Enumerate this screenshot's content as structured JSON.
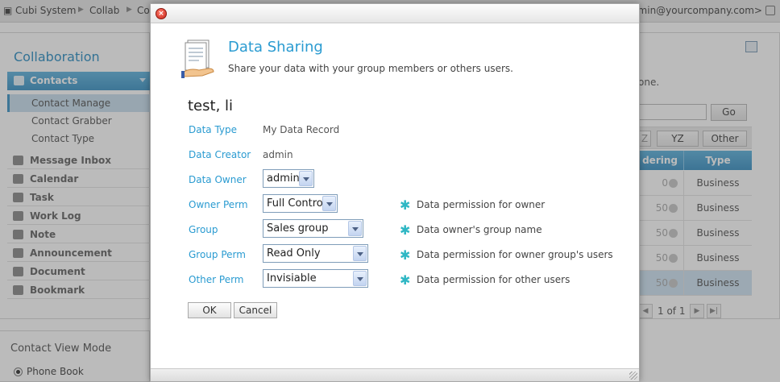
{
  "topbar": {
    "breadcrumbs": [
      "Cubi System",
      "Collab",
      "Co"
    ],
    "user": "admin@yourcompany.com>"
  },
  "sidebar": {
    "title": "Collaboration",
    "contacts_label": "Contacts",
    "subitems": [
      "Contact Manage",
      "Contact Grabber",
      "Contact Type"
    ],
    "items": [
      "Message Inbox",
      "Calendar",
      "Task",
      "Work Log",
      "Note",
      "Announcement",
      "Document",
      "Bookmark"
    ]
  },
  "view_mode": {
    "title": "Contact View Mode",
    "option": "Phone Book"
  },
  "main": {
    "note_fragment": "one.",
    "go_label": "Go",
    "alpha_buttons": [
      "Z",
      "YZ",
      "Other"
    ],
    "col_ordering": "dering",
    "col_type": "Type",
    "rows": [
      {
        "order": "0",
        "type": "Business"
      },
      {
        "order": "50",
        "type": "Business"
      },
      {
        "order": "50",
        "type": "Business"
      },
      {
        "order": "50",
        "type": "Business"
      },
      {
        "order": "50",
        "type": "Business"
      }
    ],
    "page_info": "1 of 1"
  },
  "dialog": {
    "title": "Data Sharing",
    "subtitle": "Share your data with your group members or others users.",
    "record_name": "test, li",
    "fields": {
      "data_type": {
        "label": "Data Type",
        "value": "My Data Record"
      },
      "data_creator": {
        "label": "Data Creator",
        "value": "admin"
      },
      "data_owner": {
        "label": "Data Owner",
        "value": "admin"
      },
      "owner_perm": {
        "label": "Owner Perm",
        "value": "Full Control",
        "hint": "Data permission for owner"
      },
      "group": {
        "label": "Group",
        "value": "Sales group",
        "hint": "Data owner's group name"
      },
      "group_perm": {
        "label": "Group Perm",
        "value": "Read Only",
        "hint": "Data permission for owner group's users"
      },
      "other_perm": {
        "label": "Other Perm",
        "value": "Invisiable",
        "hint": "Data permission for other users"
      }
    },
    "hint_marker": "✱",
    "ok_label": "OK",
    "cancel_label": "Cancel"
  },
  "colors": {
    "accent": "#2a9bd1",
    "header_blue": "#3f95c6",
    "hint_star": "#2fb7c4"
  }
}
